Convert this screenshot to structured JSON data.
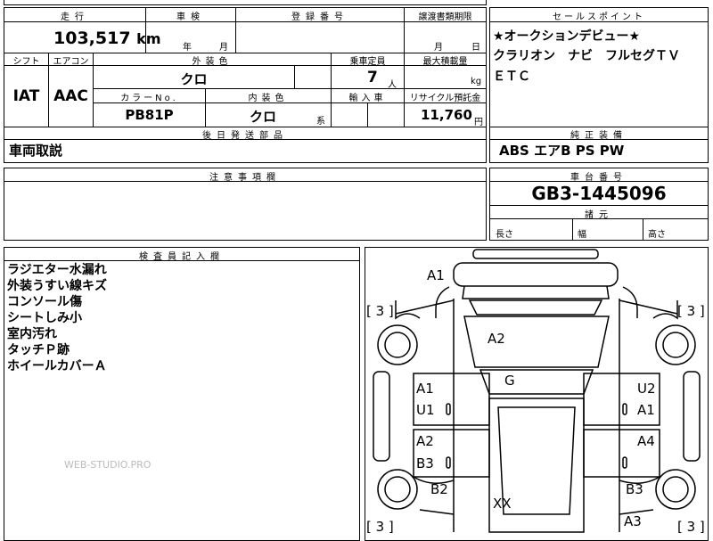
{
  "main_table": {
    "mileage_header": "走行",
    "mileage_value": "103,517",
    "mileage_unit": "km",
    "shaken_header": "車検",
    "shaken_year": "年",
    "shaken_month": "月",
    "reg_header": "登録番号",
    "transfer_header": "譲渡書類期限",
    "transfer_month": "月",
    "transfer_day": "日",
    "shift_header": "シフト",
    "shift_value": "IAT",
    "aircon_header": "エアコン",
    "aircon_value": "AAC",
    "exterior_header": "外装色",
    "exterior_value": "クロ",
    "capacity_header": "乗車定員",
    "capacity_value": "7",
    "capacity_unit": "人",
    "maxload_header": "最大積載量",
    "maxload_unit": "kg",
    "colorno_header": "カラーNo.",
    "colorno_value": "PB81P",
    "interior_header": "内装色",
    "interior_value": "クロ",
    "interior_suffix": "系",
    "import_header": "輸入車",
    "recycle_header": "リサイクル預託金",
    "recycle_value": "11,760",
    "recycle_unit": "円",
    "later_header": "後日発送部品",
    "later_value": "車両取説"
  },
  "sales_point": {
    "header": "セールスポイント",
    "lines": [
      "★オークションデビュー★",
      "クラリオン　ナビ　フルセグＴＶ",
      "ＥＴＣ"
    ]
  },
  "equipment": {
    "header": "純正装備",
    "value": "ABS エアB PS PW"
  },
  "caution": {
    "header": "注意事項欄"
  },
  "chassis": {
    "header": "車台番号",
    "value": "GB3-1445096",
    "dims_header": "諸元",
    "length_label": "長さ",
    "width_label": "幅",
    "height_label": "高さ"
  },
  "inspector": {
    "header": "検査員記入欄",
    "notes": [
      "ラジエター水漏れ",
      "外装うすい線キズ",
      "コンソール傷",
      "シートしみ小",
      "室内汚れ",
      "タッチＰ跡",
      "ホイールカバーＡ"
    ]
  },
  "watermark": "WEB-STUDIO.PRO",
  "diagram": {
    "tires": [
      "[ 3 ]",
      "[ 3 ]",
      "[ 3 ]",
      "[ 3 ]"
    ],
    "marks": {
      "front_bumper": "A1",
      "roof": "A2",
      "glass": "G",
      "left_front_door_1": "A1",
      "left_front_door_2": "U1",
      "right_front_door_1": "U2",
      "right_front_door_2": "A1",
      "left_rear_door_1": "A2",
      "left_rear_door_2": "B3",
      "right_rear_door": "A4",
      "left_rear_fender": "B2",
      "right_rear_fender": "B3",
      "rear_center": "XX",
      "rear_right": "A3"
    }
  }
}
